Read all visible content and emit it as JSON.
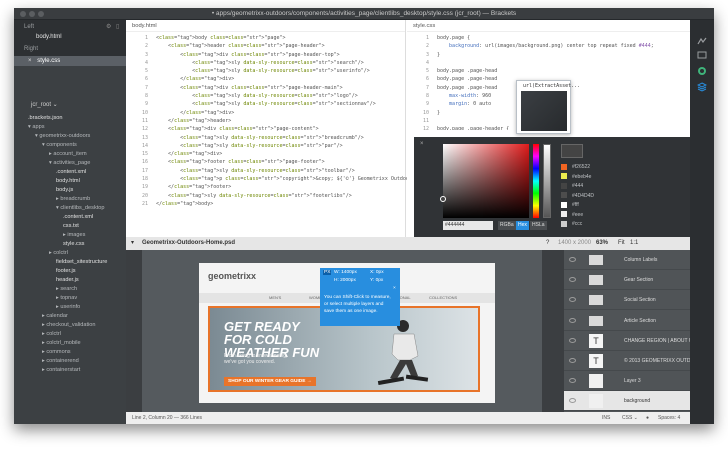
{
  "window": {
    "title": "• apps/geometrixx-outdoors/components/activities_page/clientlibs_desktop/style.css (jcr_root) — Brackets"
  },
  "sidebar": {
    "working_files_header": "Left",
    "left_files": [
      "body.html"
    ],
    "right_header": "Right",
    "right_files": [
      "style.css"
    ],
    "project_root": "jcr_root ⌄",
    "tree": [
      {
        "label": ".brackets.json",
        "indent": 0,
        "type": "file"
      },
      {
        "label": "▾ apps",
        "indent": 0,
        "type": "folder"
      },
      {
        "label": "▾ geometrixx-outdoors",
        "indent": 1,
        "type": "folder"
      },
      {
        "label": "▾ components",
        "indent": 2,
        "type": "folder"
      },
      {
        "label": "▸ account_item",
        "indent": 3,
        "type": "folder"
      },
      {
        "label": "▾ activities_page",
        "indent": 3,
        "type": "folder"
      },
      {
        "label": ".content.xml",
        "indent": 4,
        "type": "file"
      },
      {
        "label": "body.html",
        "indent": 4,
        "type": "file"
      },
      {
        "label": "body.js",
        "indent": 4,
        "type": "file"
      },
      {
        "label": "▸ breadcrumb",
        "indent": 4,
        "type": "folder"
      },
      {
        "label": "▾ clientlibs_desktop",
        "indent": 4,
        "type": "folder"
      },
      {
        "label": ".content.xml",
        "indent": 5,
        "type": "file"
      },
      {
        "label": "css.txt",
        "indent": 5,
        "type": "file"
      },
      {
        "label": "▸ images",
        "indent": 5,
        "type": "folder"
      },
      {
        "label": "style.css",
        "indent": 5,
        "type": "file"
      },
      {
        "label": "▸ colctrl",
        "indent": 3,
        "type": "folder"
      },
      {
        "label": "fieldset_sitestructure",
        "indent": 4,
        "type": "file"
      },
      {
        "label": "footer.js",
        "indent": 4,
        "type": "file"
      },
      {
        "label": "header.js",
        "indent": 4,
        "type": "file"
      },
      {
        "label": "▸ search",
        "indent": 4,
        "type": "folder"
      },
      {
        "label": "▸ topnav",
        "indent": 4,
        "type": "folder"
      },
      {
        "label": "▸ userinfo",
        "indent": 4,
        "type": "folder"
      },
      {
        "label": "▸ calendar",
        "indent": 2,
        "type": "folder"
      },
      {
        "label": "▸ checkout_validation",
        "indent": 2,
        "type": "folder"
      },
      {
        "label": "▸ colctrl",
        "indent": 2,
        "type": "folder"
      },
      {
        "label": "▸ colctrl_mobile",
        "indent": 2,
        "type": "folder"
      },
      {
        "label": "▸ commons",
        "indent": 2,
        "type": "folder"
      },
      {
        "label": "▸ containerend",
        "indent": 2,
        "type": "folder"
      },
      {
        "label": "▸ containerstart",
        "indent": 2,
        "type": "folder"
      }
    ]
  },
  "left_pane": {
    "filename": "body.html",
    "lines": [
      {
        "n": "1",
        "code": "<body class=\"page\">"
      },
      {
        "n": "2",
        "code": "    <header class=\"page-header\">"
      },
      {
        "n": "3",
        "code": "        <div class=\"page-header-top\">"
      },
      {
        "n": "4",
        "code": "            <sly data-sly-resource=\"search\"/>"
      },
      {
        "n": "5",
        "code": "            <sly data-sly-resource=\"userinfo\"/>"
      },
      {
        "n": "6",
        "code": "        </div>"
      },
      {
        "n": "7",
        "code": "        <div class=\"page-header-main\">"
      },
      {
        "n": "8",
        "code": "            <sly data-sly-resource=\"logo\"/>"
      },
      {
        "n": "9",
        "code": "            <sly data-sly-resource=\"sectionnav\"/>"
      },
      {
        "n": "10",
        "code": "        </div>"
      },
      {
        "n": "11",
        "code": "    </header>"
      },
      {
        "n": "12",
        "code": "    <div class=\"page-content\">"
      },
      {
        "n": "13",
        "code": "        <sly data-sly-resource=\"breadcrumb\"/>"
      },
      {
        "n": "14",
        "code": "        <sly data-sly-resource=\"par\"/>"
      },
      {
        "n": "15",
        "code": "    </div>"
      },
      {
        "n": "16",
        "code": "    <footer class=\"page-footer\">"
      },
      {
        "n": "17",
        "code": "        <sly data-sly-resource=\"toolbar\"/>"
      },
      {
        "n": "18",
        "code": "        <p class=\"copyright\">&copy; ${'©'} Geometrixx Outdoors. All rights re"
      },
      {
        "n": "19",
        "code": "    </footer>"
      },
      {
        "n": "20",
        "code": "    <sly data-sly-resource=\"footerlibs\"/>"
      },
      {
        "n": "21",
        "code": "</body>"
      }
    ]
  },
  "right_pane": {
    "filename": "style.css",
    "lines": [
      {
        "n": "1",
        "code": "body.page {"
      },
      {
        "n": "2",
        "code": "    background: url(images/background.png) center top repeat fixed #444;"
      },
      {
        "n": "3",
        "code": "}"
      },
      {
        "n": "4",
        "code": ""
      },
      {
        "n": "5",
        "code": "body.page .page-head"
      },
      {
        "n": "6",
        "code": "body.page .page-head"
      },
      {
        "n": "7",
        "code": "body.page .page-head"
      },
      {
        "n": "8",
        "code": "    max-width: 960"
      },
      {
        "n": "9",
        "code": "    margin: 0 auto"
      },
      {
        "n": "10",
        "code": "}"
      },
      {
        "n": "11",
        "code": ""
      },
      {
        "n": "12",
        "code": "body.page .page-header {"
      },
      {
        "n": "13",
        "code": "    background: #444;"
      }
    ],
    "inline_tip": "url(ExtractAsset..."
  },
  "color_picker": {
    "hex_value": "#444444",
    "formats": [
      "RGBa",
      "Hex",
      "HSLa"
    ],
    "active_format": "Hex",
    "swatches": [
      {
        "color": "#f26522",
        "label": "#f26522"
      },
      {
        "color": "#ebeb4e",
        "label": "#ebeb4e"
      },
      {
        "color": "#444444",
        "label": "#444"
      },
      {
        "color": "#4d4d4d",
        "label": "#4D4D4D"
      },
      {
        "color": "#ffffff",
        "label": "#fff"
      },
      {
        "color": "#eeeeee",
        "label": "#eee"
      },
      {
        "color": "#cccccc",
        "label": "#ccc"
      }
    ]
  },
  "extract": {
    "filename": "Geometrixx-Outdoors-Home.psd",
    "dimensions": "1400 x 2000",
    "zoom": "63%",
    "fit": "Fit",
    "ratio": "1:1",
    "layers": [
      {
        "label": "Column Labels",
        "kind": "folder"
      },
      {
        "label": "Gear Section",
        "kind": "folder"
      },
      {
        "label": "Social Section",
        "kind": "folder"
      },
      {
        "label": "Article Section",
        "kind": "folder"
      },
      {
        "label": "CHANGE REGION | ABOUT US |",
        "kind": "text"
      },
      {
        "label": "© 2013 GEOMETRIXX OUTDOOR",
        "kind": "text"
      },
      {
        "label": "Layer 3",
        "kind": "image"
      },
      {
        "label": "background",
        "kind": "image"
      }
    ],
    "tooltip": {
      "w": "W: 1400px",
      "h": "H: 2000px",
      "x": "X: 0px",
      "y": "Y: 0px",
      "px": "PX",
      "message": "You can Shift-Click to measure, or select multiple layers and save them as one image."
    },
    "site": {
      "logo": "geometrixx",
      "logo_sub": "OUTDOORS",
      "nav": [
        "MEN'S",
        "WOMEN'S",
        "EQUIPMENT",
        "SEASONAL",
        "COLLECTIONS"
      ],
      "hero_line1": "GET READY",
      "hero_line2": "FOR COLD",
      "hero_line3": "WEATHER FUN",
      "hero_sub": "From skiing to snowshoeing, we've got you covered.",
      "hero_button": "SHOP OUR WINTER GEAR GUIDE →"
    }
  },
  "statusbar": {
    "position": "Line 2, Column 20 — 366 Lines",
    "ins": "INS",
    "mode": "CSS ⌄",
    "spaces": "Spaces: 4"
  }
}
